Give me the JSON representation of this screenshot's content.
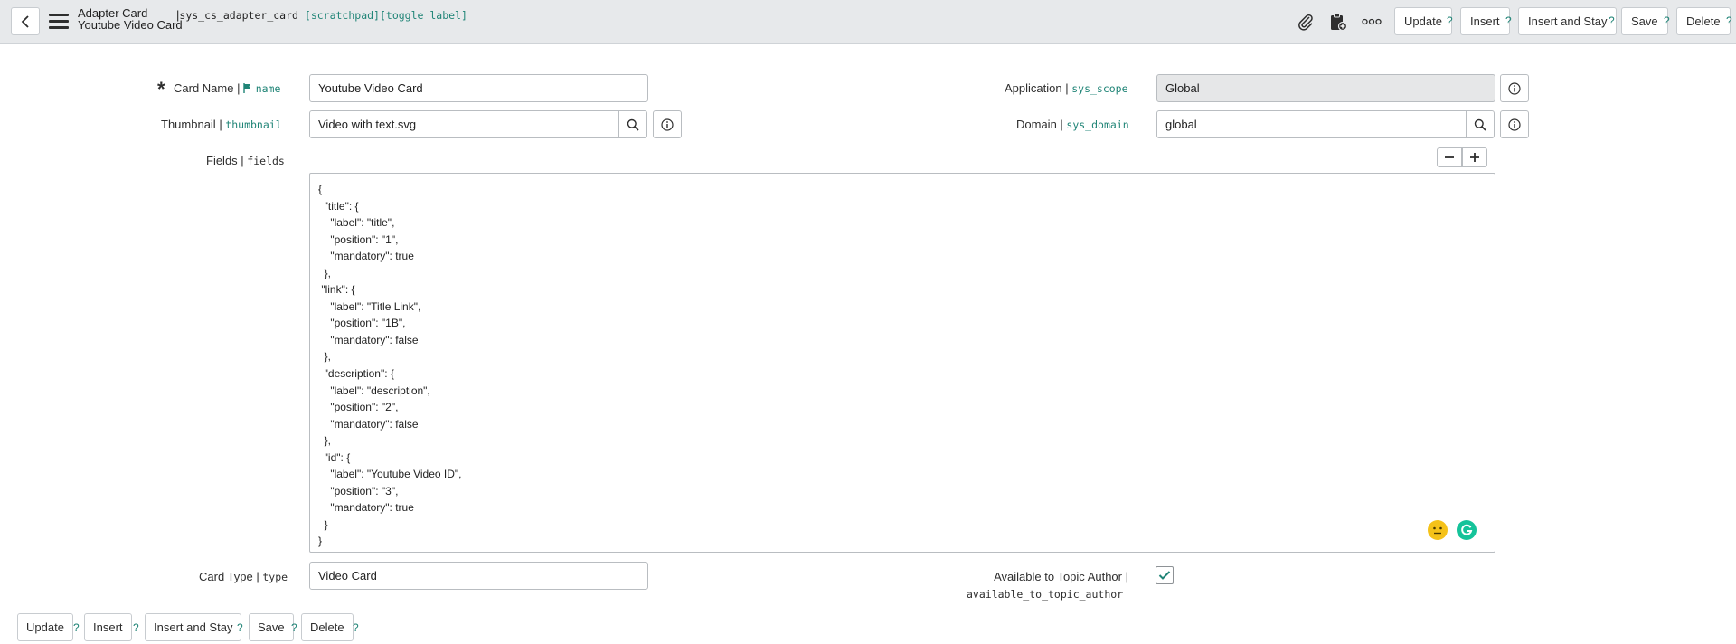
{
  "header": {
    "title": "Adapter Card",
    "subtitle": "Youtube Video Card",
    "table_name": "sys_cs_adapter_card",
    "tags": "[scratchpad][toggle label]",
    "separator": "|",
    "buttons": {
      "update": "Update",
      "insert": "Insert",
      "insert_and_stay": "Insert and Stay",
      "save": "Save",
      "delete": "Delete"
    },
    "help_mark": "?"
  },
  "form": {
    "card_name": {
      "label": "Card Name",
      "field": "name",
      "value": "Youtube Video Card"
    },
    "thumbnail": {
      "label": "Thumbnail",
      "field": "thumbnail",
      "value": "Video with text.svg"
    },
    "application": {
      "label": "Application",
      "field": "sys_scope",
      "value": "Global"
    },
    "domain": {
      "label": "Domain",
      "field": "sys_domain",
      "value": "global"
    },
    "fields": {
      "label": "Fields",
      "field": "fields",
      "lines": [
        "{",
        "  \"title\": {",
        "    \"label\": \"title\",",
        "    \"position\": \"1\",",
        "    \"mandatory\": true",
        "  },",
        " \"link\": {",
        "    \"label\": \"Title Link\",",
        "    \"position\": \"1B\",",
        "    \"mandatory\": false",
        "  },",
        "  \"description\": {",
        "    \"label\": \"description\",",
        "    \"position\": \"2\",",
        "    \"mandatory\": false",
        "  },",
        "  \"id\": {",
        "    \"label\": \"Youtube Video ID\",",
        "    \"position\": \"3\",",
        "    \"mandatory\": true",
        "  }",
        "}"
      ]
    },
    "card_type": {
      "label": "Card Type",
      "field": "type",
      "value": "Video Card"
    },
    "available_to_topic_author": {
      "label": "Available to Topic Author",
      "field": "available_to_topic_author",
      "checked": true
    }
  },
  "footer": {
    "buttons": {
      "update": "Update",
      "insert": "Insert",
      "insert_and_stay": "Insert and Stay",
      "save": "Save",
      "delete": "Delete"
    }
  },
  "colors": {
    "header_bg": "#e7e9eb",
    "field_name": "#1f8476",
    "readonly_bg": "#e6e7e8"
  }
}
